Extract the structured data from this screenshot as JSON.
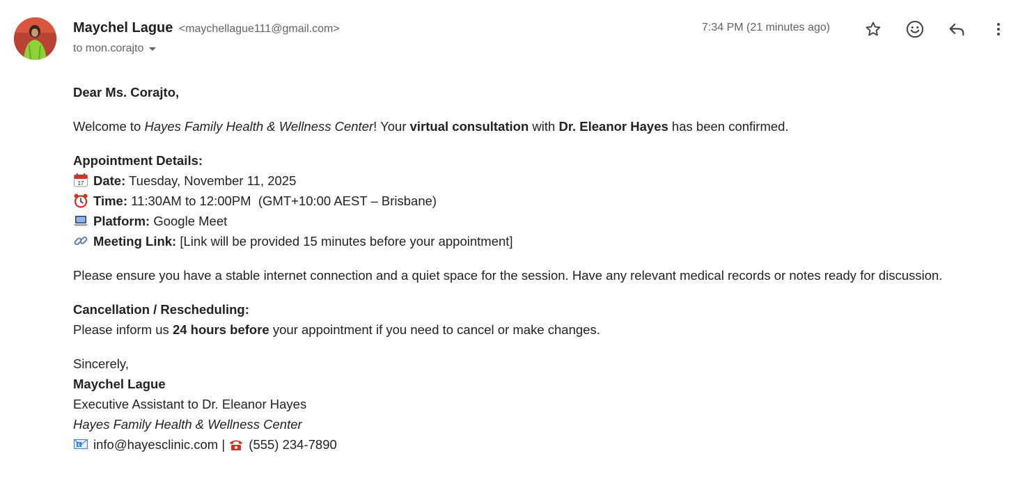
{
  "sender": {
    "name": "Maychel Lague",
    "email": "<maychellague111@gmail.com>",
    "to": "to mon.corajto"
  },
  "header": {
    "timestamp": "7:34 PM (21 minutes ago)",
    "icons": [
      "star-icon",
      "emoji-reaction-icon",
      "reply-icon",
      "more-vert-icon"
    ]
  },
  "body": {
    "greeting": "Dear Ms. Corajto,",
    "welcome": {
      "t1": "Welcome to ",
      "clinic": "Hayes Family Health & Wellness Center",
      "t2": "! Your ",
      "consult": "virtual consultation",
      "t3": " with ",
      "doctor": "Dr. Eleanor Hayes",
      "t4": " has been confirmed."
    },
    "details": {
      "heading": "Appointment Details:",
      "date_label": "Date:",
      "date_value": " Tuesday, November 11, 2025",
      "time_label": "Time:",
      "time_value": " 11:30AM to 12:00PM  (GMT+10:00 AEST – Brisbane)",
      "platform_label": "Platform:",
      "platform_value": " Google Meet",
      "link_label": "Meeting Link:",
      "link_value": " [Link will be provided 15 minutes before your appointment]"
    },
    "ensure": "Please ensure you have a stable internet connection and a quiet space for the session. Have any relevant medical records or notes ready for discussion.",
    "cancel": {
      "heading": "Cancellation / Rescheduling:",
      "t1": "Please inform us ",
      "bold": "24 hours before",
      "t2": " your appointment if you need to cancel or make changes."
    },
    "signoff": {
      "closing": "Sincerely,",
      "name": "Maychel Lague",
      "title": "Executive Assistant to Dr. Eleanor Hayes",
      "clinic": "Hayes Family Health & Wellness Center",
      "email": "info@hayesclinic.com",
      "sep": " | ",
      "phone": "(555) 234-7890"
    }
  },
  "colors": {
    "accent_text": "#202124",
    "muted_text": "#5f6368"
  }
}
